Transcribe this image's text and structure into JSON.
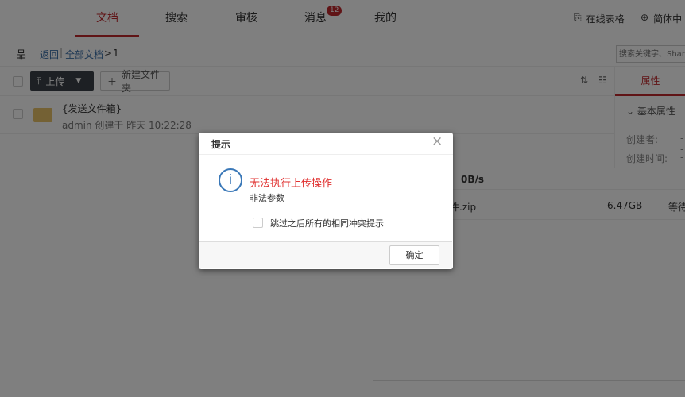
{
  "nav": {
    "tabs": [
      {
        "label": "文档"
      },
      {
        "label": "搜索"
      },
      {
        "label": "审核"
      },
      {
        "label": "消息"
      },
      {
        "label": "我的"
      }
    ],
    "message_count": "12",
    "online_sheet": "在线表格",
    "language": "简体中"
  },
  "breadcrumb": {
    "back": "返回",
    "root": "全部文档",
    "separator": ">",
    "current": "1"
  },
  "search": {
    "placeholder": "搜索关键字、Shar"
  },
  "toolbar": {
    "upload": "上传",
    "new_folder": "新建文件夹"
  },
  "files": [
    {
      "name": "{发送文件箱}",
      "meta": "admin 创建于 昨天 10:22:28"
    }
  ],
  "side": {
    "tab": "属性",
    "section": "基本属性",
    "creator_label": "创建者:",
    "creator_value": "--",
    "created_label": "创建时间:",
    "created_value": "--"
  },
  "upload_panel": {
    "speed": "0B/s",
    "file_name": "件.zip",
    "file_size": "6.47GB",
    "file_status": "等待"
  },
  "dialog": {
    "title": "提示",
    "message": "无法执行上传操作",
    "detail": "非法参数",
    "checkbox": "跳过之后所有的相同冲突提示",
    "ok": "确定"
  },
  "colors": {
    "accent": "#c0282d",
    "info": "#3a78b8"
  }
}
